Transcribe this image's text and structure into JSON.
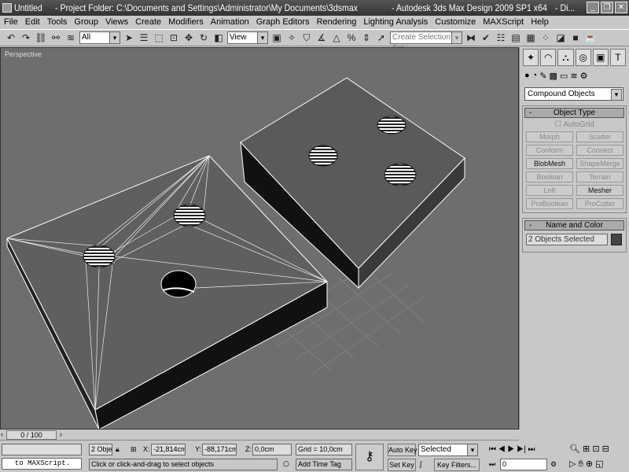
{
  "title": {
    "doc": "Untitled",
    "project": "- Project Folder: C:\\Documents and Settings\\Administrator\\My Documents\\3dsmax",
    "app": "- Autodesk 3ds Max Design 2009 SP1  x64",
    "extra": "- Di..."
  },
  "menu": [
    "File",
    "Edit",
    "Tools",
    "Group",
    "Views",
    "Create",
    "Modifiers",
    "Animation",
    "Graph Editors",
    "Rendering",
    "Lighting Analysis",
    "Customize",
    "MAXScript",
    "Help"
  ],
  "toolbar": {
    "filter": "All",
    "coord": "View",
    "selection_set": "Create Selection Set"
  },
  "viewport": {
    "label": "Perspective"
  },
  "panel": {
    "category": "Compound Objects",
    "object_type_title": "Object Type",
    "autogrid": "AutoGrid",
    "buttons": [
      {
        "label": "Morph",
        "enabled": false
      },
      {
        "label": "Scatter",
        "enabled": false
      },
      {
        "label": "Conform",
        "enabled": false
      },
      {
        "label": "Connect",
        "enabled": false
      },
      {
        "label": "BlobMesh",
        "enabled": true
      },
      {
        "label": "ShapeMerge",
        "enabled": false
      },
      {
        "label": "Boolean",
        "enabled": false
      },
      {
        "label": "Terrain",
        "enabled": false
      },
      {
        "label": "Loft",
        "enabled": false
      },
      {
        "label": "Mesher",
        "enabled": true
      },
      {
        "label": "ProBoolean",
        "enabled": false
      },
      {
        "label": "ProCutter",
        "enabled": false
      }
    ],
    "name_color_title": "Name and Color",
    "name_value": "2 Objects Selected",
    "color": "#444444"
  },
  "status": {
    "frame": "0 / 100",
    "listener": "to MAXScript.",
    "selected_count": "2 Obje",
    "x_label": "X:",
    "x": "-21,814cm",
    "y_label": "Y:",
    "y": "-88,171cm",
    "z_label": "Z:",
    "z": "0,0cm",
    "grid": "Grid = 10,0cm",
    "prompt": "Click or click-and-drag to select objects",
    "add_time_tag": "Add Time Tag",
    "auto_key": "Auto Key",
    "set_key": "Set Key",
    "key_mode": "Selected",
    "key_filters": "Key Filters...",
    "current_frame": "0"
  }
}
